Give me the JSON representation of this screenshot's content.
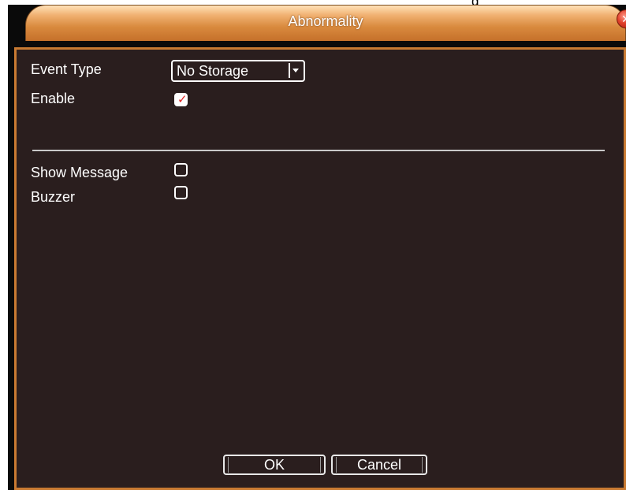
{
  "background": {
    "partial_text": "g"
  },
  "window": {
    "title": "Abnormality",
    "close_icon": "close-icon",
    "colors": {
      "title_bar": "#d98a3e",
      "panel_bg": "#2a1e1e",
      "border": "#c87a32",
      "checkmark": "#e02020"
    }
  },
  "form": {
    "event_type": {
      "label": "Event Type",
      "selected": "No Storage"
    },
    "enable": {
      "label": "Enable",
      "checked": true
    },
    "show_message": {
      "label": "Show Message",
      "checked": false
    },
    "buzzer": {
      "label": "Buzzer",
      "checked": false
    }
  },
  "buttons": {
    "ok": "OK",
    "cancel": "Cancel"
  }
}
